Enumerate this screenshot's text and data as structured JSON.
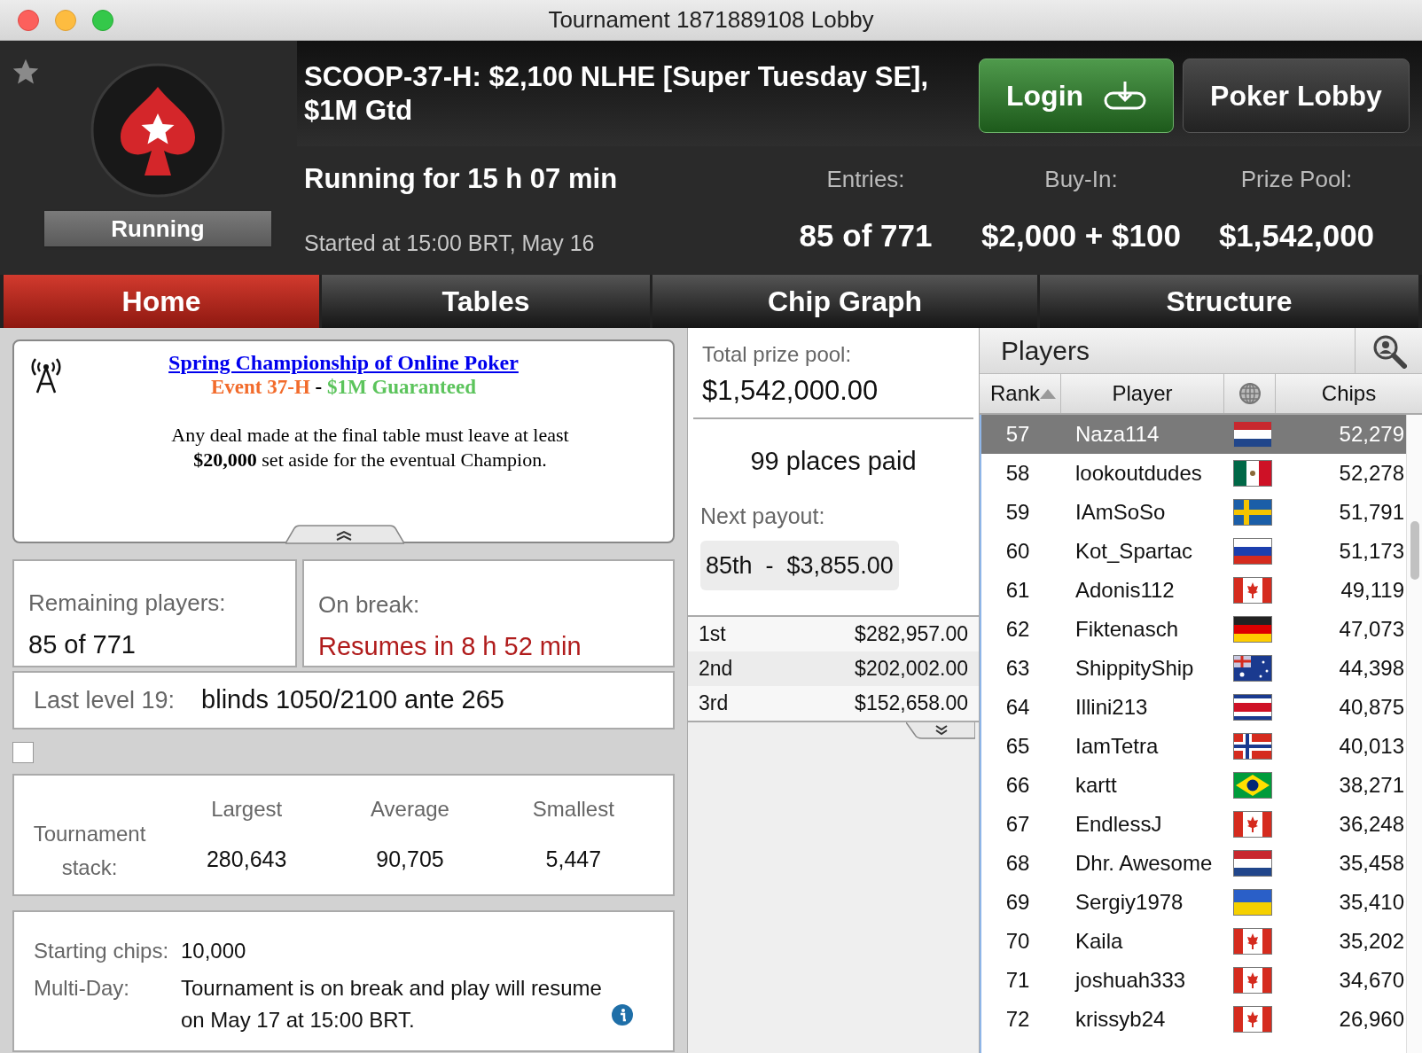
{
  "window": {
    "title": "Tournament 1871889108 Lobby"
  },
  "header": {
    "status": "Running",
    "title_line_1": "SCOOP-37-H: $2,100 NLHE [Super Tuesday SE],",
    "title_line_2": "$1M Gtd",
    "running_for": "Running for 15 h 07 min",
    "started": "Started at 15:00 BRT, May 16",
    "buttons": [
      {
        "label": "Login",
        "kind": "login"
      },
      {
        "label": "Poker Lobby",
        "kind": "plain"
      }
    ],
    "stats": [
      {
        "label": "Entries:",
        "value": "85 of 771"
      },
      {
        "label": "Buy-In:",
        "value": "$2,000 + $100"
      },
      {
        "label": "Prize Pool:",
        "value": "$1,542,000"
      }
    ]
  },
  "tabs": [
    {
      "label": "Home",
      "selected": true
    },
    {
      "label": "Tables",
      "selected": false
    },
    {
      "label": "Chip Graph",
      "selected": false
    },
    {
      "label": "Structure",
      "selected": false
    }
  ],
  "notice": {
    "link": "Spring Championship of Online Poker",
    "subtitle_parts": [
      {
        "text": "Event 37-H",
        "color": "#f26b2b"
      },
      {
        "text": " - ",
        "color": "#000000"
      },
      {
        "text": "$1M Guaranteed",
        "color": "#5cc45c"
      }
    ],
    "body": "Any deal made at the final table must leave at least **$20,000** set aside for the eventual Champion."
  },
  "remaining": {
    "label": "Remaining players:",
    "value": "85 of 771"
  },
  "break": {
    "label": "On break:",
    "value": "Resumes in 8 h 52 min"
  },
  "last_level": {
    "label": "Last level 19:",
    "value": "blinds 1050/2100 ante 265"
  },
  "option_checkbox": {
    "checked": false
  },
  "stack": {
    "label": "Tournament stack:",
    "columns": [
      {
        "label": "Largest",
        "value": "280,643"
      },
      {
        "label": "Average",
        "value": "90,705"
      },
      {
        "label": "Smallest",
        "value": "5,447"
      }
    ]
  },
  "info": [
    {
      "label": "Starting chips:",
      "value": "10,000"
    },
    {
      "label": "Multi-Day:",
      "value": "Tournament is on break and play will resume on May 17 at 15:00 BRT.",
      "info_icon": true
    }
  ],
  "prizes": {
    "total_label": "Total prize pool:",
    "total": "$1,542,000.00",
    "places_paid": "99 places paid",
    "next_label": "Next payout:",
    "next": "85th  -  $3,855.00",
    "places": [
      {
        "place": "1st",
        "amount": "$282,957.00"
      },
      {
        "place": "2nd",
        "amount": "$202,002.00"
      },
      {
        "place": "3rd",
        "amount": "$152,658.00"
      }
    ]
  },
  "players": {
    "title": "Players",
    "columns": [
      "Rank",
      "Player",
      "Chips"
    ],
    "rows": [
      {
        "rank": "57",
        "name": "Naza114",
        "kind": "netherlands",
        "chips": "52,279",
        "selected": true
      },
      {
        "rank": "58",
        "name": "lookoutdudes",
        "kind": "mexico",
        "chips": "52,278",
        "selected": false
      },
      {
        "rank": "59",
        "name": "IAmSoSo",
        "kind": "sweden",
        "chips": "51,791",
        "selected": false
      },
      {
        "rank": "60",
        "name": "Kot_Spartac",
        "kind": "russia",
        "chips": "51,173",
        "selected": false
      },
      {
        "rank": "61",
        "name": "Adonis112",
        "kind": "canada",
        "chips": "49,119",
        "selected": false
      },
      {
        "rank": "62",
        "name": "Fiktenasch",
        "kind": "germany",
        "chips": "47,073",
        "selected": false
      },
      {
        "rank": "63",
        "name": "ShippityShip",
        "kind": "australia",
        "chips": "44,398",
        "selected": false
      },
      {
        "rank": "64",
        "name": "Illini213",
        "kind": "costa_rica",
        "chips": "40,875",
        "selected": false
      },
      {
        "rank": "65",
        "name": "IamTetra",
        "kind": "norway",
        "chips": "40,013",
        "selected": false
      },
      {
        "rank": "66",
        "name": "kartt",
        "kind": "brazil",
        "chips": "38,271",
        "selected": false
      },
      {
        "rank": "67",
        "name": "EndlessJ",
        "kind": "canada",
        "chips": "36,248",
        "selected": false
      },
      {
        "rank": "68",
        "name": "Dhr. Awesome",
        "kind": "netherlands",
        "chips": "35,458",
        "selected": false
      },
      {
        "rank": "69",
        "name": "Sergiy1978",
        "kind": "ukraine",
        "chips": "35,410",
        "selected": false
      },
      {
        "rank": "70",
        "name": "Kaila",
        "kind": "canada",
        "chips": "35,202",
        "selected": false
      },
      {
        "rank": "71",
        "name": "joshuah333",
        "kind": "canada",
        "chips": "34,670",
        "selected": false
      },
      {
        "rank": "72",
        "name": "krissyb24",
        "kind": "canada",
        "chips": "26,960",
        "selected": false
      }
    ]
  }
}
